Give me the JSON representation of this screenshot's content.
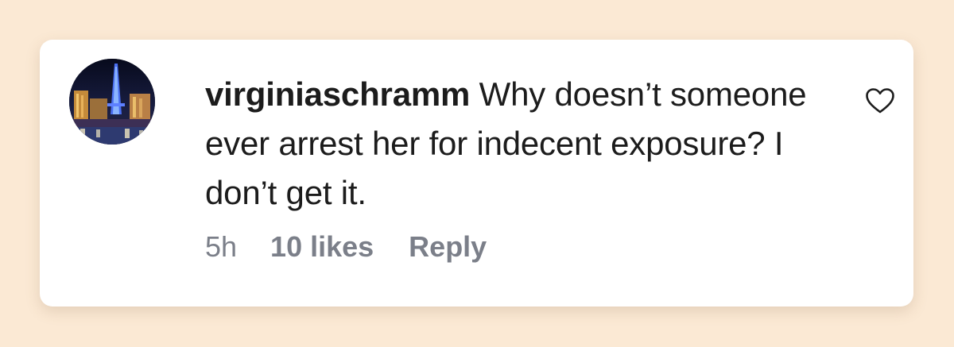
{
  "comment": {
    "username": "virginiaschramm",
    "text": "Why doesn’t someone ever arrest her for indecent exposure? I don’t get it.",
    "timestamp": "5h",
    "likes_label": "10 likes",
    "reply_label": "Reply"
  },
  "icons": {
    "like": "heart-outline-icon",
    "avatar": "user-avatar-image"
  },
  "colors": {
    "background": "#fbe9d4",
    "card": "#ffffff",
    "text": "#1c1c1c",
    "meta": "#7b7f89"
  }
}
